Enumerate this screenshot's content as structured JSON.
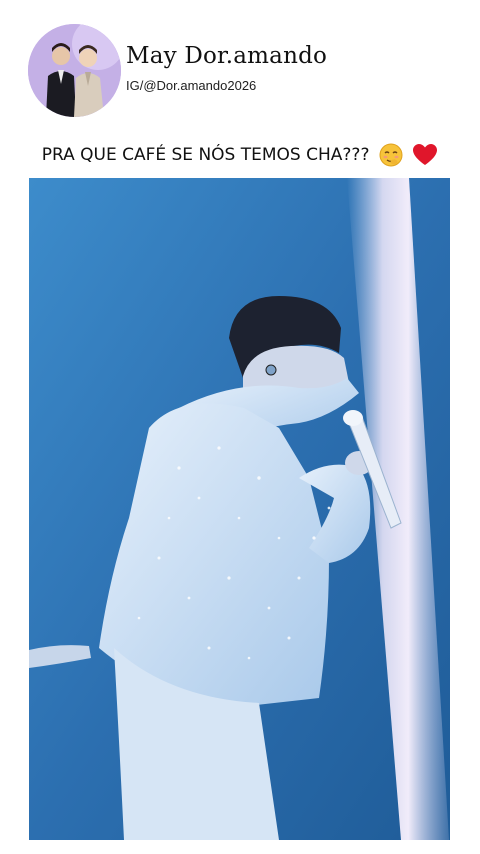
{
  "profile": {
    "name": "May Dor.amando",
    "handle": "IG/@Dor.amando2026",
    "avatar": "profile-photo-two-men-purple-background"
  },
  "post": {
    "caption_text": "PRA QUE CAFÉ SE NÓS TEMOS CHA???",
    "caption_emojis": [
      "smiling-face-emoji",
      "red-heart-emoji"
    ]
  },
  "video": {
    "content": "concert-performer-in-sparkly-white-outfit-singing-into-microphone",
    "background_color": "#2f74b4"
  },
  "colors": {
    "page_background": "#ffffff",
    "avatar_background": "#c9b4e8",
    "heart": "#e0162b",
    "stage_blue": "#2f74b4"
  }
}
